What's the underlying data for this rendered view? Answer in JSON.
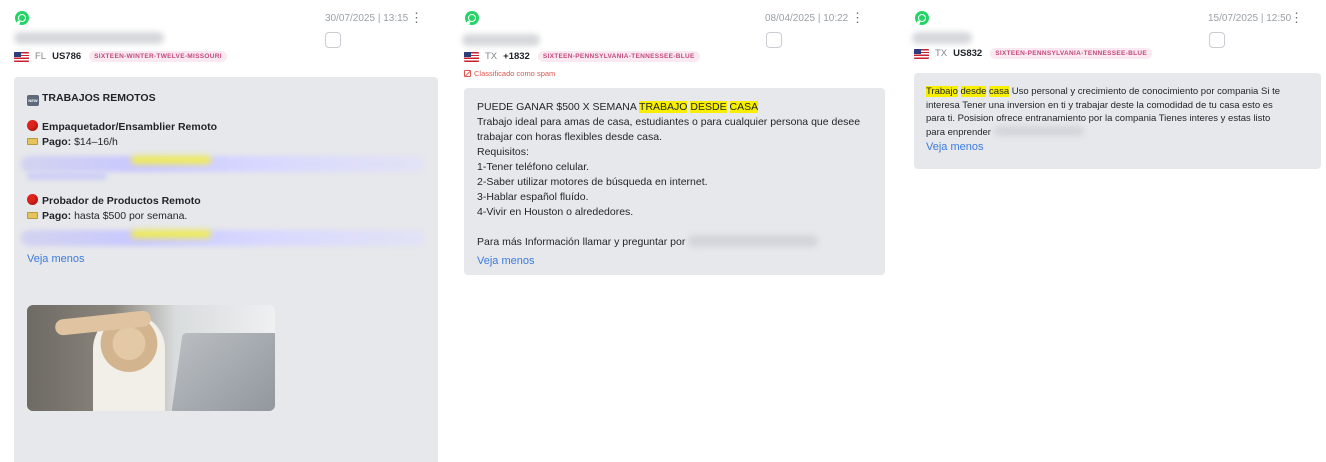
{
  "colors": {
    "whatsapp": "#25d366",
    "bubble_bg": "#e6e8ec",
    "highlight": "#f8ef00",
    "link": "#3d7bd9",
    "tag_text": "#c24a7d",
    "tag_bg": "#fbe9f1",
    "spam": "#e0574f"
  },
  "cards": [
    {
      "timestamp": "30/07/2025 | 13:15",
      "kebab": "⋮",
      "state": "FL",
      "code": "US786",
      "tag": "SIXTEEN-WINTER-TWELVE-MISSOURI",
      "title_icon": "new-icon",
      "title": "TRABAJOS REMOTOS",
      "job1_title": "Empaquetador/Ensamblier Remoto",
      "job1_pay_label": "Pago:",
      "job1_pay_value": " $14–16/h",
      "job2_title": "Probador de Productos Remoto",
      "job2_pay_label": "Pago:",
      "job2_pay_value": " hasta $500 por semana.",
      "see_less": "Veja menos"
    },
    {
      "timestamp": "08/04/2025 | 10:22",
      "kebab": "⋮",
      "state": "TX",
      "code": "+1832",
      "tag": "SIXTEEN-PENNSYLVANIA-TENNESSEE-BLUE",
      "spam_note": "Classificado como spam",
      "line1_pre": "PUEDE GANAR $500 X SEMANA ",
      "hl1": "TRABAJO",
      "hl2": "DESDE",
      "hl3": "CASA",
      "line2": "Trabajo ideal para amas de casa, estudiantes o para cualquier persona que desee",
      "line3": "trabajar con horas flexibles desde casa.",
      "line4": "Requisitos:",
      "line5": "1-Tener teléfono celular.",
      "line6": "2-Saber utilizar motores de búsqueda en internet.",
      "line7": "3-Hablar español fluído.",
      "line8": "4-Vivir en Houston o alrededores.",
      "line9": "Para más Información llamar y preguntar por",
      "see_less": "Veja menos"
    },
    {
      "timestamp": "15/07/2025 | 12:50",
      "kebab": "⋮",
      "state": "TX",
      "code": "US832",
      "tag": "SIXTEEN-PENNSYLVANIA-TENNESSEE-BLUE",
      "hl1": "Trabajo",
      "hl2": "desde",
      "hl3": "casa",
      "body1": " Uso personal y crecimiento de conocimiento por compania Si te",
      "body2": "interesa Tener una inversion en ti y trabajar deste la comodidad de tu casa esto es",
      "body3": "para ti. Posision ofrece entranamiento por la compania Tienes interes y estas listo",
      "body4": "para enprender",
      "see_less": "Veja menos"
    }
  ]
}
